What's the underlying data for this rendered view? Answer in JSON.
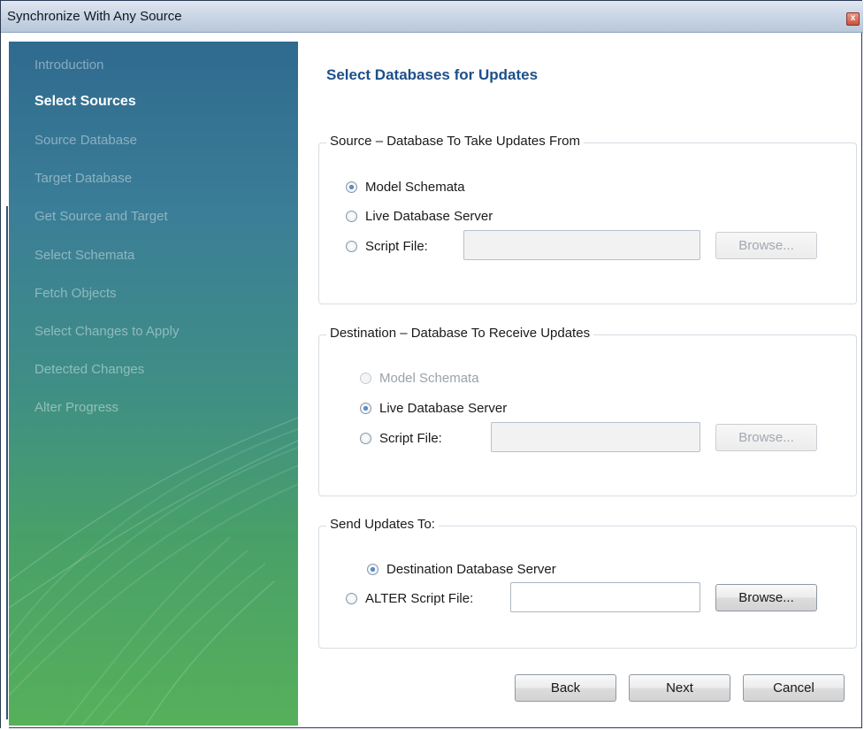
{
  "window": {
    "title": "Synchronize With Any Source",
    "close_glyph": "x"
  },
  "sidebar": {
    "items": [
      {
        "label": "Introduction",
        "state": "done"
      },
      {
        "label": "Select Sources",
        "state": "active"
      },
      {
        "label": "Source Database",
        "state": "pending"
      },
      {
        "label": "Target Database",
        "state": "pending"
      },
      {
        "label": "Get Source and Target",
        "state": "pending"
      },
      {
        "label": "Select Schemata",
        "state": "pending"
      },
      {
        "label": "Fetch Objects",
        "state": "pending"
      },
      {
        "label": "Select Changes to Apply",
        "state": "pending"
      },
      {
        "label": "Detected Changes",
        "state": "pending"
      },
      {
        "label": "Alter Progress",
        "state": "pending"
      }
    ]
  },
  "page": {
    "heading": "Select Databases for Updates"
  },
  "source_group": {
    "legend": "Source – Database To Take Updates From",
    "option_model": "Model Schemata",
    "option_live": "Live Database Server",
    "option_script": "Script File:",
    "selected": "Model Schemata",
    "script_path": "",
    "browse_label": "Browse..."
  },
  "destination_group": {
    "legend": "Destination – Database To Receive Updates",
    "option_model": "Model Schemata",
    "option_live": "Live Database Server",
    "option_script": "Script File:",
    "selected": "Live Database Server",
    "script_path": "",
    "browse_label": "Browse..."
  },
  "send_group": {
    "legend": "Send Updates To:",
    "option_destination": "Destination Database Server",
    "option_alter": "ALTER Script File:",
    "selected": "Destination Database Server",
    "alter_path": "",
    "browse_label": "Browse..."
  },
  "footer": {
    "back_label": "Back",
    "next_label": "Next",
    "cancel_label": "Cancel"
  },
  "colors": {
    "heading": "#1d4f8a",
    "sidebar_top": "#2f6a8f",
    "sidebar_bottom": "#56b05a",
    "radio_dot": "#1d5ea8"
  }
}
